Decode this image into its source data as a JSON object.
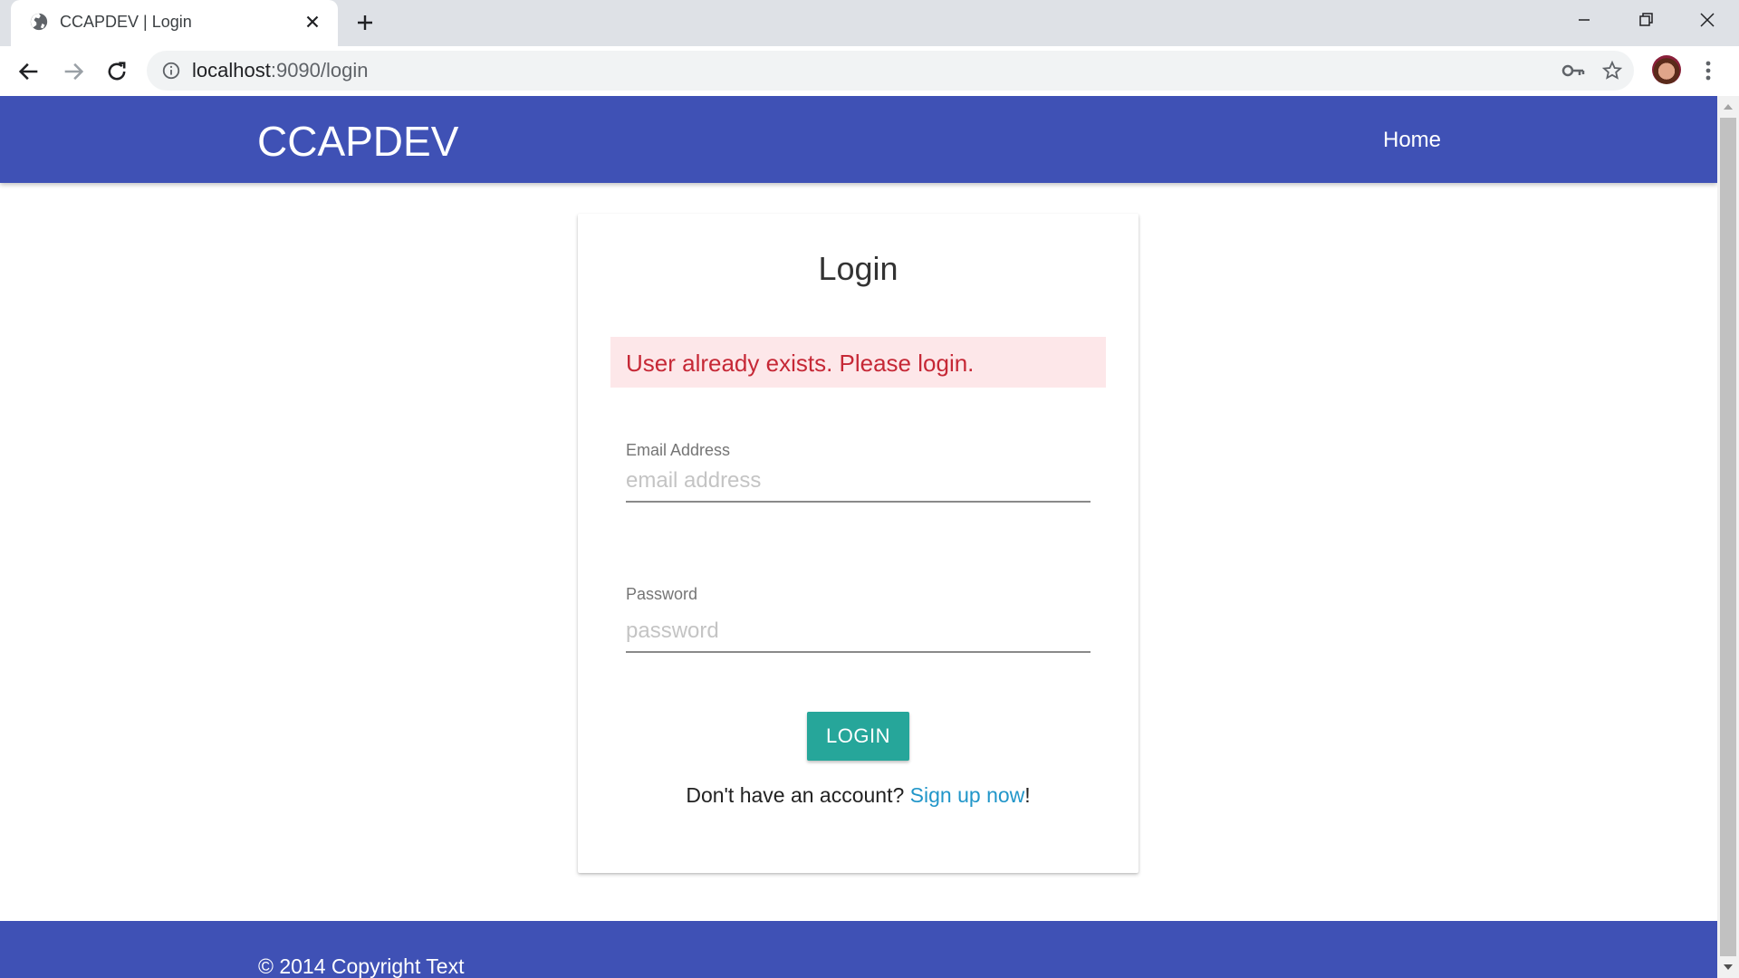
{
  "browser": {
    "tab_title": "CCAPDEV | Login",
    "url_host": "localhost",
    "url_path": ":9090/login"
  },
  "site": {
    "brand": "CCAPDEV",
    "nav_home": "Home",
    "footer_text": "© 2014 Copyright Text"
  },
  "login": {
    "title": "Login",
    "alert": "User already exists. Please login.",
    "email_label": "Email Address",
    "email_placeholder": "email address",
    "password_label": "Password",
    "password_placeholder": "password",
    "button_label": "LOGIN",
    "signup_prefix": "Don't have an account? ",
    "signup_link": "Sign up now",
    "signup_suffix": "!"
  },
  "colors": {
    "primary": "#3f51b5",
    "button": "#26a69a",
    "alert_bg": "#fde7e9",
    "alert_text": "#c62836",
    "link": "#2196c9"
  }
}
